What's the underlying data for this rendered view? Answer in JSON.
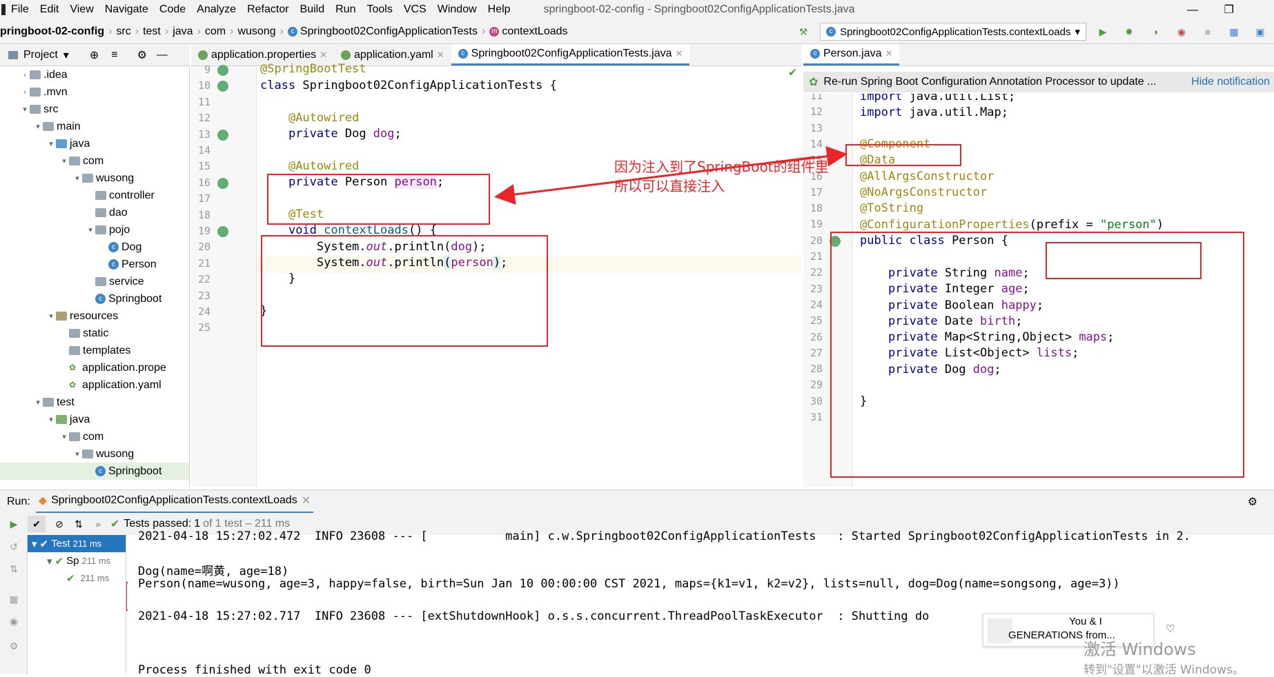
{
  "menubar": {
    "items": [
      "File",
      "Edit",
      "View",
      "Navigate",
      "Code",
      "Analyze",
      "Refactor",
      "Build",
      "Run",
      "Tools",
      "VCS",
      "Window",
      "Help"
    ],
    "title": "springboot-02-config - Springboot02ConfigApplicationTests.java"
  },
  "breadcrumb": {
    "project": "pringboot-02-config",
    "parts": [
      "src",
      "test",
      "java",
      "com",
      "wusong"
    ],
    "class": "Springboot02ConfigApplicationTests",
    "method": "contextLoads"
  },
  "run_config": "Springboot02ConfigApplicationTests.contextLoads",
  "project_panel": {
    "title": "Project",
    "tree": [
      {
        "label": ".idea",
        "depth": 1,
        "arrow": "right",
        "icon": "folder"
      },
      {
        "label": ".mvn",
        "depth": 1,
        "arrow": "right",
        "icon": "folder"
      },
      {
        "label": "src",
        "depth": 1,
        "arrow": "down",
        "icon": "folder"
      },
      {
        "label": "main",
        "depth": 2,
        "arrow": "down",
        "icon": "folder"
      },
      {
        "label": "java",
        "depth": 3,
        "arrow": "down",
        "icon": "folder-blue"
      },
      {
        "label": "com",
        "depth": 4,
        "arrow": "down",
        "icon": "folder"
      },
      {
        "label": "wusong",
        "depth": 5,
        "arrow": "down",
        "icon": "folder"
      },
      {
        "label": "controller",
        "depth": 6,
        "arrow": "",
        "icon": "folder"
      },
      {
        "label": "dao",
        "depth": 6,
        "arrow": "",
        "icon": "folder"
      },
      {
        "label": "pojo",
        "depth": 6,
        "arrow": "down",
        "icon": "folder"
      },
      {
        "label": "Dog",
        "depth": 7,
        "arrow": "",
        "icon": "class"
      },
      {
        "label": "Person",
        "depth": 7,
        "arrow": "",
        "icon": "class"
      },
      {
        "label": "service",
        "depth": 6,
        "arrow": "",
        "icon": "folder"
      },
      {
        "label": "Springboot",
        "depth": 6,
        "arrow": "",
        "icon": "class"
      },
      {
        "label": "resources",
        "depth": 3,
        "arrow": "down",
        "icon": "folder-res"
      },
      {
        "label": "static",
        "depth": 4,
        "arrow": "",
        "icon": "folder"
      },
      {
        "label": "templates",
        "depth": 4,
        "arrow": "",
        "icon": "folder"
      },
      {
        "label": "application.prope",
        "depth": 4,
        "arrow": "",
        "icon": "leaf"
      },
      {
        "label": "application.yaml",
        "depth": 4,
        "arrow": "",
        "icon": "leaf"
      },
      {
        "label": "test",
        "depth": 2,
        "arrow": "down",
        "icon": "folder"
      },
      {
        "label": "java",
        "depth": 3,
        "arrow": "down",
        "icon": "folder-green"
      },
      {
        "label": "com",
        "depth": 4,
        "arrow": "down",
        "icon": "folder"
      },
      {
        "label": "wusong",
        "depth": 5,
        "arrow": "down",
        "icon": "folder"
      },
      {
        "label": "Springboot",
        "depth": 6,
        "arrow": "",
        "icon": "class",
        "selected": true
      }
    ]
  },
  "editor_left": {
    "tabs": [
      "application.properties",
      "application.yaml",
      "Springboot02ConfigApplicationTests.java"
    ],
    "active_tab": 2,
    "line_numbers": [
      "9",
      "10",
      "11",
      "12",
      "13",
      "14",
      "15",
      "16",
      "17",
      "18",
      "19",
      "20",
      "21",
      "22",
      "23",
      "24",
      "25"
    ]
  },
  "editor_right": {
    "tab": "Person.java",
    "notification": "Re-run Spring Boot Configuration Annotation Processor to update ...",
    "notification_link": "Hide notification",
    "line_numbers": [
      "11",
      "12",
      "13",
      "14",
      "15",
      "16",
      "17",
      "18",
      "19",
      "20",
      "21",
      "22",
      "23",
      "24",
      "25",
      "26",
      "27",
      "28",
      "29",
      "30",
      "31"
    ]
  },
  "annotation_text": [
    "因为注入到了SpringBoot的组件里",
    "所以可以直接注入"
  ],
  "run_panel": {
    "label": "Run:",
    "tab": "Springboot02ConfigApplicationTests.contextLoads",
    "status_prefix": "Tests passed:",
    "status_count": "1",
    "status_suffix": "of 1 test – 211 ms",
    "tests": [
      {
        "name": "Test",
        "time": "211 ms"
      },
      {
        "name": "Sp",
        "time": "211 ms"
      },
      {
        "name": "",
        "time": "211 ms"
      }
    ],
    "console": [
      "2021-04-18 15:27:02.472  INFO 23608 --- [           main] c.w.Springboot02ConfigApplicationTests   : Started Springboot02ConfigApplicationTests in 2.",
      "",
      "Dog(name=啊黄, age=18)",
      "Person(name=wusong, age=3, happy=false, birth=Sun Jan 10 00:00:00 CST 2021, maps={k1=v1, k2=v2}, lists=null, dog=Dog(name=songsong, age=3))",
      "",
      "2021-04-18 15:27:02.717  INFO 23608 --- [extShutdownHook] o.s.s.concurrent.ThreadPoolTaskExecutor  : Shutting do",
      "",
      "Process finished with exit code 0"
    ]
  },
  "toast": {
    "line1": "You & I",
    "line2": "GENERATIONS from..."
  },
  "watermark": {
    "line1": "激活 Windows",
    "line2": "转到\"设置\"以激活 Windows。"
  },
  "colors": {
    "accent": "#4083c9",
    "annotation_red": "#e8262a",
    "test_pass": "#4e9a3e"
  }
}
